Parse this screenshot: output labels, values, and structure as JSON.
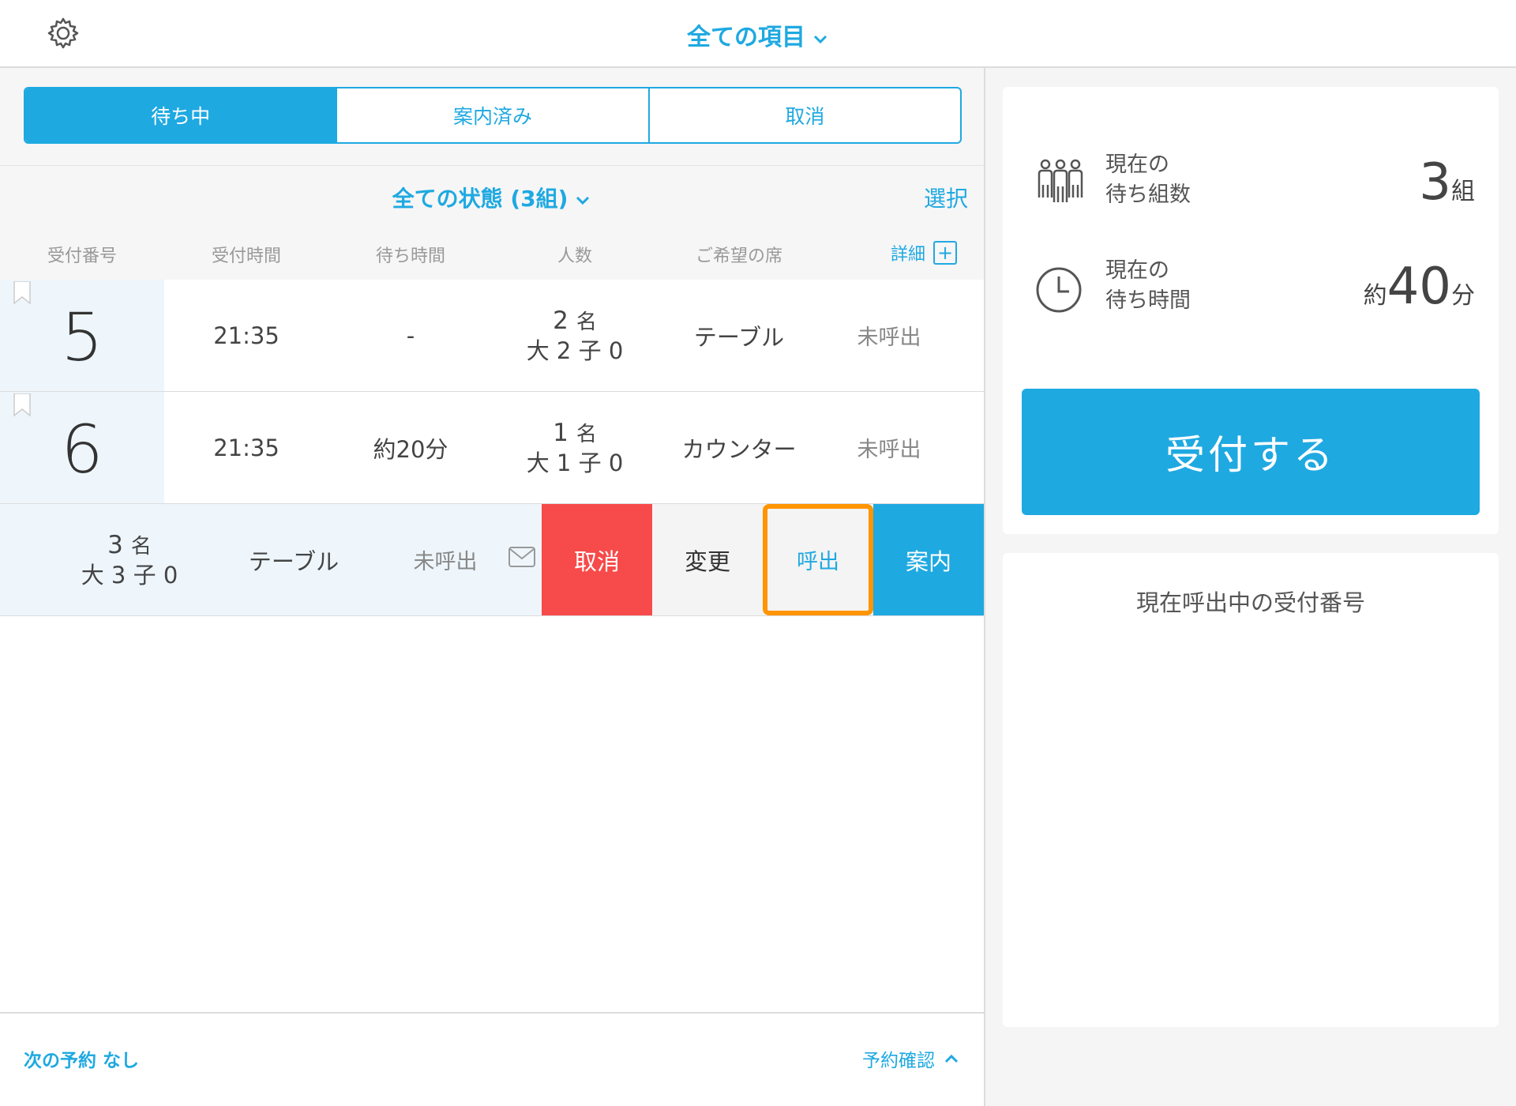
{
  "header": {
    "title": "全ての項目"
  },
  "tabs": [
    "待ち中",
    "案内済み",
    "取消"
  ],
  "filter": {
    "title": "全ての状態 (3組)",
    "select_label": "選択",
    "detail_label": "詳細"
  },
  "columns": [
    "受付番号",
    "受付時間",
    "待ち時間",
    "人数",
    "ご希望の席"
  ],
  "rows": [
    {
      "number": "5",
      "time": "21:35",
      "wait": "-",
      "people": "2",
      "people_unit": "名",
      "breakdown": "大 2 子 0",
      "seat": "テーブル",
      "status": "未呼出"
    },
    {
      "number": "6",
      "time": "21:35",
      "wait": "約20分",
      "people": "1",
      "people_unit": "名",
      "breakdown": "大 1 子 0",
      "seat": "カウンター",
      "status": "未呼出"
    }
  ],
  "swiped_row": {
    "people": "3",
    "people_unit": "名",
    "breakdown": "大 3 子 0",
    "seat": "テーブル",
    "status": "未呼出",
    "actions": {
      "cancel": "取消",
      "change": "変更",
      "call": "呼出",
      "guide": "案内"
    }
  },
  "footer": {
    "next_reservation": "次の予約 なし",
    "reservation_check": "予約確認"
  },
  "stats": {
    "groups_label_1": "現在の",
    "groups_label_2": "待ち組数",
    "groups_value": "3",
    "groups_unit": "組",
    "wait_label_1": "現在の",
    "wait_label_2": "待ち時間",
    "wait_prefix": "約",
    "wait_value": "40",
    "wait_unit": "分"
  },
  "register_button": "受付する",
  "calling_title": "現在呼出中の受付番号",
  "colors": {
    "accent": "#1fa9e1",
    "cancel": "#f74a4a",
    "highlight": "#ff9500"
  },
  "icons": [
    "gear-icon",
    "chevron-down-icon",
    "bookmark-icon",
    "plus-icon",
    "mail-icon",
    "people-icon",
    "clock-icon",
    "chevron-up-icon"
  ]
}
